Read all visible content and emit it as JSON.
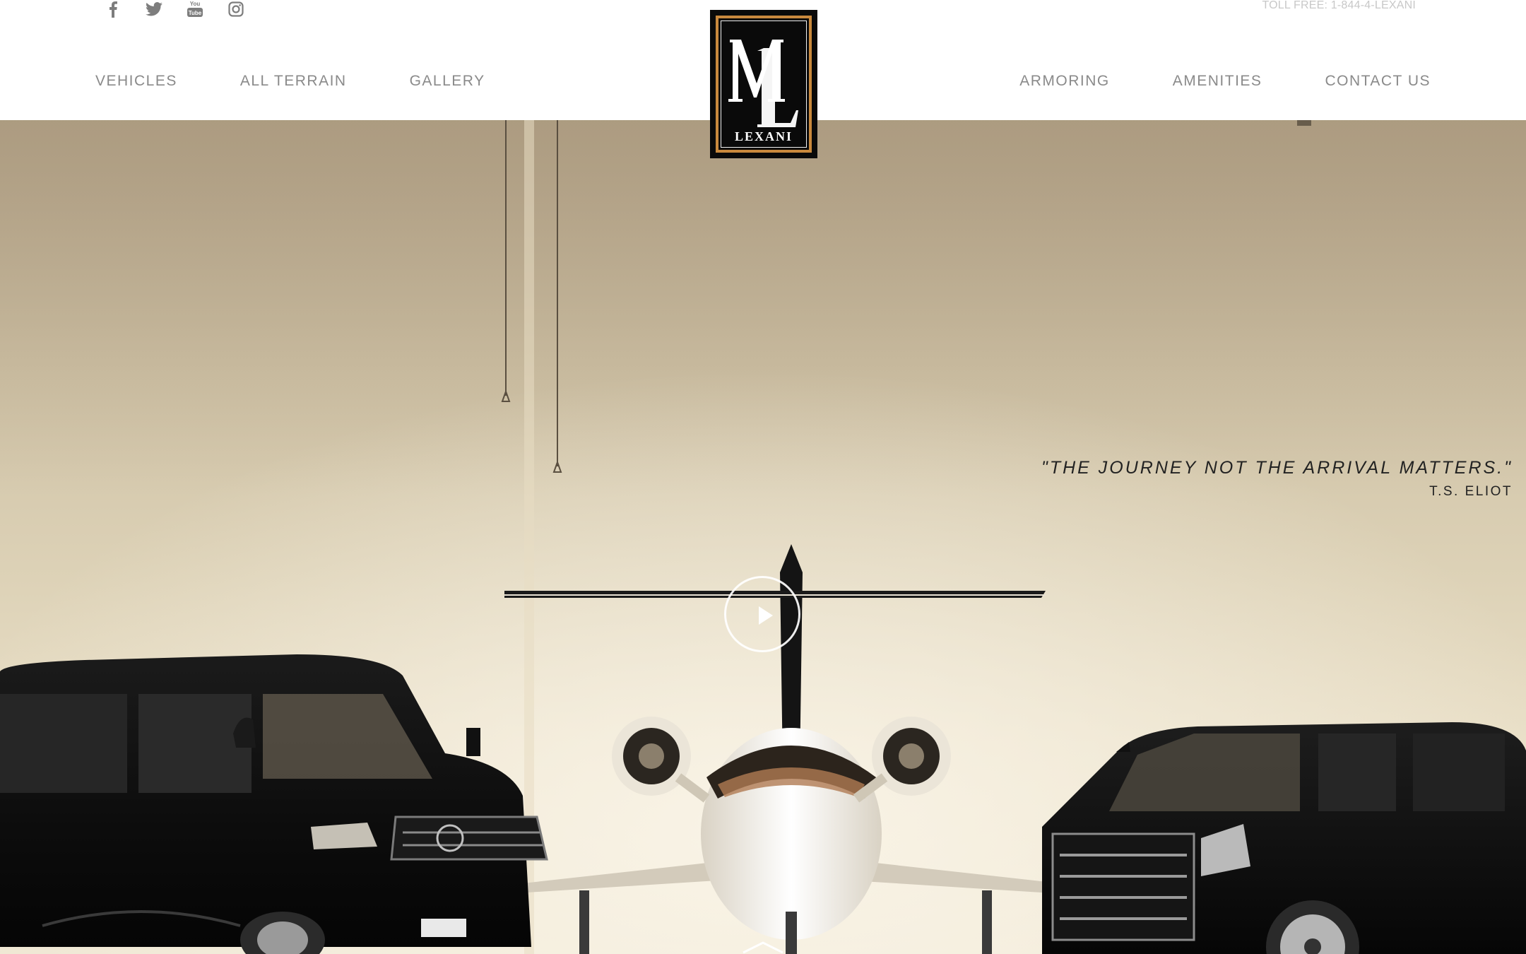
{
  "header": {
    "toll_free": "TOLL FREE: 1-844-4-LEXANI",
    "social": [
      {
        "name": "facebook"
      },
      {
        "name": "twitter"
      },
      {
        "name": "youtube",
        "glyph_text": "You Tube"
      },
      {
        "name": "instagram"
      }
    ],
    "nav_left": [
      "VEHICLES",
      "ALL TERRAIN",
      "GALLERY"
    ],
    "nav_right": [
      "ARMORING",
      "AMENITIES",
      "CONTACT US"
    ]
  },
  "logo": {
    "monogram": "ML",
    "wordmark": "LEXANI",
    "accent_color": "#c9893d"
  },
  "hero": {
    "quote": "\"THE JOURNEY NOT THE ARRIVAL MATTERS.\"",
    "quote_author": "T.S. ELIOT",
    "play_icon": "play-icon",
    "scroll_icon": "chevron-down-icon"
  }
}
